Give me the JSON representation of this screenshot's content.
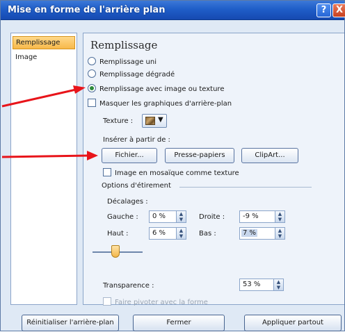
{
  "window": {
    "title": "Mise en forme de l'arrière plan",
    "help_label": "?",
    "close_label": "X"
  },
  "nav": {
    "items": [
      {
        "label": "Remplissage",
        "selected": true
      },
      {
        "label": "Image",
        "selected": false
      }
    ]
  },
  "fill": {
    "heading": "Remplissage",
    "options": [
      {
        "label": "Remplissage uni",
        "selected": false
      },
      {
        "label": "Remplissage dégradé",
        "selected": false
      },
      {
        "label": "Remplissage avec image ou texture",
        "selected": true
      }
    ],
    "hide_graphics_label": "Masquer les graphiques d'arrière-plan",
    "texture_label": "Texture :",
    "insert_from_label": "Insérer à partir de :",
    "file_button": "Fichier...",
    "clipboard_button": "Presse-papiers",
    "clipart_button": "ClipArt...",
    "tile_label": "Image en mosaïque comme texture",
    "stretch_options_label": "Options d'étirement",
    "offsets_label": "Décalages :",
    "left_label": "Gauche :",
    "left_value": "0 %",
    "right_label": "Droite :",
    "right_value": "-9 %",
    "top_label": "Haut :",
    "top_value": "6 %",
    "bottom_label": "Bas :",
    "bottom_value": "7 %",
    "transparency_label": "Transparence :",
    "transparency_value": "53 %",
    "transparency_level": 0.53,
    "rotate_label": "Faire pivoter avec la forme"
  },
  "footer": {
    "reset_button": "Réinitialiser l'arrière-plan",
    "close_button": "Fermer",
    "apply_all_button": "Appliquer partout"
  },
  "colors": {
    "arrow": "#e8141a",
    "titlebar": "#1f5ec8",
    "selected_nav": "#f7b84a"
  }
}
